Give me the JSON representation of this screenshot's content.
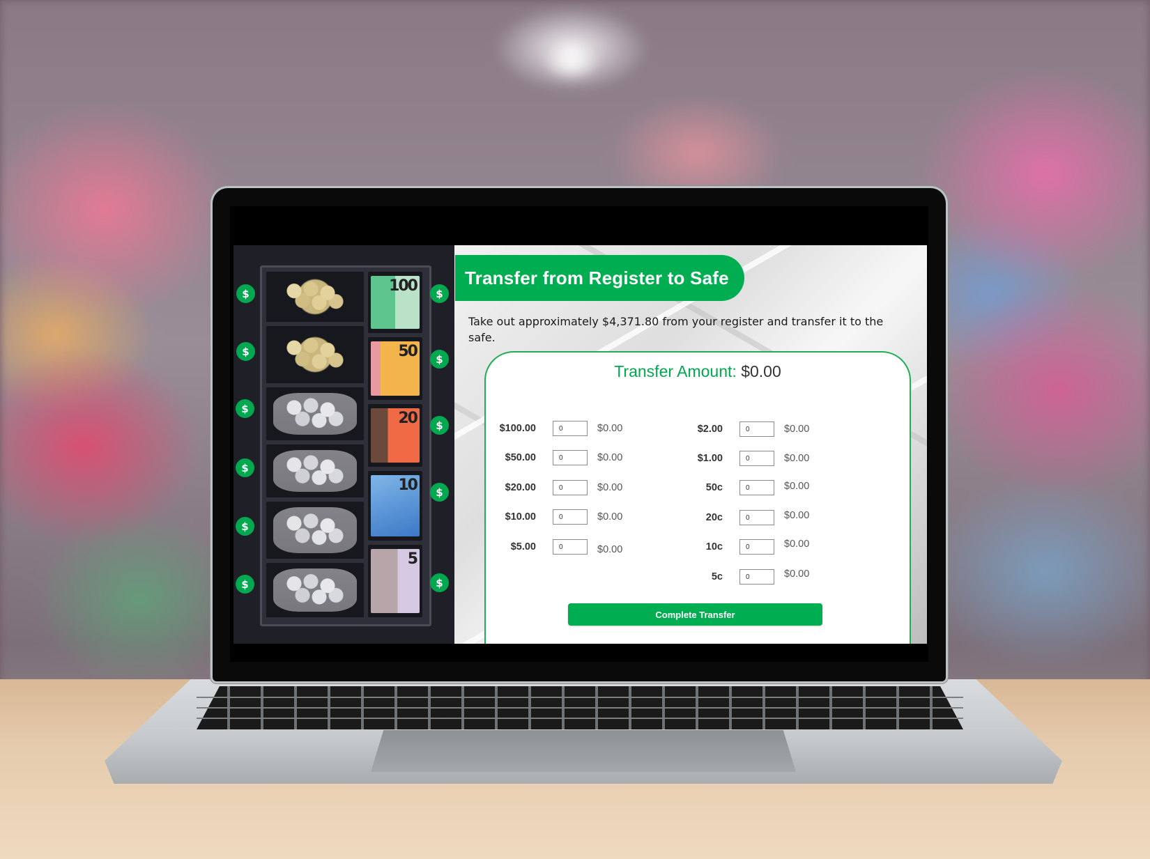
{
  "app": {
    "title": "Transfer from Register to Safe",
    "instruction": "Take out approximately $4,371.80 from your register and transfer it to the safe.",
    "transfer_amount_label": "Transfer Amount:",
    "transfer_amount_value": "$0.00",
    "complete_button": "Complete Transfer",
    "colors": {
      "accent": "#00ad50",
      "drawer_bg": "#1e1f27",
      "text": "#333333"
    }
  },
  "denominations_left": [
    {
      "label": "$100.00",
      "qty": "0",
      "subtotal": "$0.00"
    },
    {
      "label": "$50.00",
      "qty": "0",
      "subtotal": "$0.00"
    },
    {
      "label": "$20.00",
      "qty": "0",
      "subtotal": "$0.00"
    },
    {
      "label": "$10.00",
      "qty": "0",
      "subtotal": "$0.00"
    },
    {
      "label": "$5.00",
      "qty": "0",
      "subtotal": "$0.00"
    }
  ],
  "denominations_right": [
    {
      "label": "$2.00",
      "qty": "0",
      "subtotal": "$0.00"
    },
    {
      "label": "$1.00",
      "qty": "0",
      "subtotal": "$0.00"
    },
    {
      "label": "50c",
      "qty": "0",
      "subtotal": "$0.00"
    },
    {
      "label": "20c",
      "qty": "0",
      "subtotal": "$0.00"
    },
    {
      "label": "10c",
      "qty": "0",
      "subtotal": "$0.00"
    },
    {
      "label": "5c",
      "qty": "0",
      "subtotal": "$0.00"
    }
  ],
  "drawer": {
    "dollar_icon": "$",
    "notes": [
      "100",
      "50",
      "20",
      "10",
      "5"
    ],
    "coin_slots": [
      "$2 coins",
      "$1 coins",
      "50c coins",
      "20c coins",
      "10c coins",
      "5c coins"
    ]
  }
}
